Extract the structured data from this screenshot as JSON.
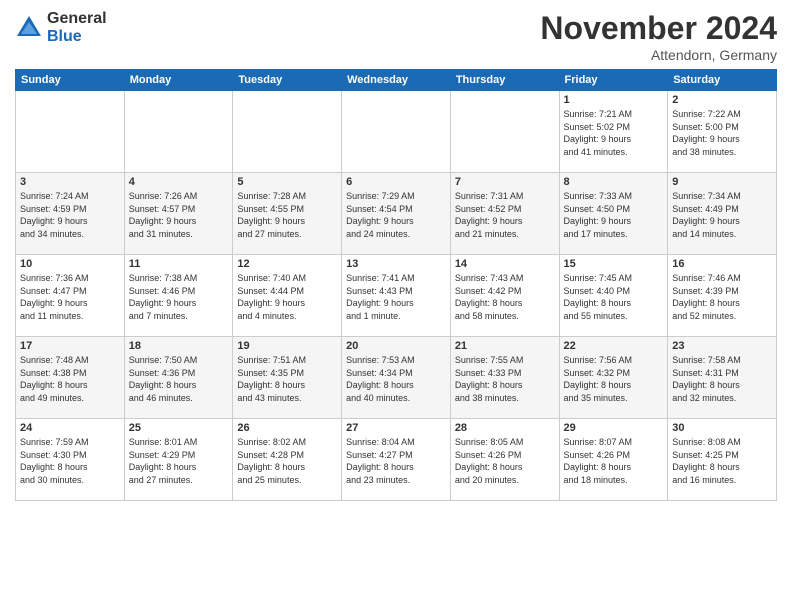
{
  "logo": {
    "general": "General",
    "blue": "Blue"
  },
  "header": {
    "month": "November 2024",
    "location": "Attendorn, Germany"
  },
  "days_of_week": [
    "Sunday",
    "Monday",
    "Tuesday",
    "Wednesday",
    "Thursday",
    "Friday",
    "Saturday"
  ],
  "weeks": [
    [
      {
        "day": "",
        "info": ""
      },
      {
        "day": "",
        "info": ""
      },
      {
        "day": "",
        "info": ""
      },
      {
        "day": "",
        "info": ""
      },
      {
        "day": "",
        "info": ""
      },
      {
        "day": "1",
        "info": "Sunrise: 7:21 AM\nSunset: 5:02 PM\nDaylight: 9 hours\nand 41 minutes."
      },
      {
        "day": "2",
        "info": "Sunrise: 7:22 AM\nSunset: 5:00 PM\nDaylight: 9 hours\nand 38 minutes."
      }
    ],
    [
      {
        "day": "3",
        "info": "Sunrise: 7:24 AM\nSunset: 4:59 PM\nDaylight: 9 hours\nand 34 minutes."
      },
      {
        "day": "4",
        "info": "Sunrise: 7:26 AM\nSunset: 4:57 PM\nDaylight: 9 hours\nand 31 minutes."
      },
      {
        "day": "5",
        "info": "Sunrise: 7:28 AM\nSunset: 4:55 PM\nDaylight: 9 hours\nand 27 minutes."
      },
      {
        "day": "6",
        "info": "Sunrise: 7:29 AM\nSunset: 4:54 PM\nDaylight: 9 hours\nand 24 minutes."
      },
      {
        "day": "7",
        "info": "Sunrise: 7:31 AM\nSunset: 4:52 PM\nDaylight: 9 hours\nand 21 minutes."
      },
      {
        "day": "8",
        "info": "Sunrise: 7:33 AM\nSunset: 4:50 PM\nDaylight: 9 hours\nand 17 minutes."
      },
      {
        "day": "9",
        "info": "Sunrise: 7:34 AM\nSunset: 4:49 PM\nDaylight: 9 hours\nand 14 minutes."
      }
    ],
    [
      {
        "day": "10",
        "info": "Sunrise: 7:36 AM\nSunset: 4:47 PM\nDaylight: 9 hours\nand 11 minutes."
      },
      {
        "day": "11",
        "info": "Sunrise: 7:38 AM\nSunset: 4:46 PM\nDaylight: 9 hours\nand 7 minutes."
      },
      {
        "day": "12",
        "info": "Sunrise: 7:40 AM\nSunset: 4:44 PM\nDaylight: 9 hours\nand 4 minutes."
      },
      {
        "day": "13",
        "info": "Sunrise: 7:41 AM\nSunset: 4:43 PM\nDaylight: 9 hours\nand 1 minute."
      },
      {
        "day": "14",
        "info": "Sunrise: 7:43 AM\nSunset: 4:42 PM\nDaylight: 8 hours\nand 58 minutes."
      },
      {
        "day": "15",
        "info": "Sunrise: 7:45 AM\nSunset: 4:40 PM\nDaylight: 8 hours\nand 55 minutes."
      },
      {
        "day": "16",
        "info": "Sunrise: 7:46 AM\nSunset: 4:39 PM\nDaylight: 8 hours\nand 52 minutes."
      }
    ],
    [
      {
        "day": "17",
        "info": "Sunrise: 7:48 AM\nSunset: 4:38 PM\nDaylight: 8 hours\nand 49 minutes."
      },
      {
        "day": "18",
        "info": "Sunrise: 7:50 AM\nSunset: 4:36 PM\nDaylight: 8 hours\nand 46 minutes."
      },
      {
        "day": "19",
        "info": "Sunrise: 7:51 AM\nSunset: 4:35 PM\nDaylight: 8 hours\nand 43 minutes."
      },
      {
        "day": "20",
        "info": "Sunrise: 7:53 AM\nSunset: 4:34 PM\nDaylight: 8 hours\nand 40 minutes."
      },
      {
        "day": "21",
        "info": "Sunrise: 7:55 AM\nSunset: 4:33 PM\nDaylight: 8 hours\nand 38 minutes."
      },
      {
        "day": "22",
        "info": "Sunrise: 7:56 AM\nSunset: 4:32 PM\nDaylight: 8 hours\nand 35 minutes."
      },
      {
        "day": "23",
        "info": "Sunrise: 7:58 AM\nSunset: 4:31 PM\nDaylight: 8 hours\nand 32 minutes."
      }
    ],
    [
      {
        "day": "24",
        "info": "Sunrise: 7:59 AM\nSunset: 4:30 PM\nDaylight: 8 hours\nand 30 minutes."
      },
      {
        "day": "25",
        "info": "Sunrise: 8:01 AM\nSunset: 4:29 PM\nDaylight: 8 hours\nand 27 minutes."
      },
      {
        "day": "26",
        "info": "Sunrise: 8:02 AM\nSunset: 4:28 PM\nDaylight: 8 hours\nand 25 minutes."
      },
      {
        "day": "27",
        "info": "Sunrise: 8:04 AM\nSunset: 4:27 PM\nDaylight: 8 hours\nand 23 minutes."
      },
      {
        "day": "28",
        "info": "Sunrise: 8:05 AM\nSunset: 4:26 PM\nDaylight: 8 hours\nand 20 minutes."
      },
      {
        "day": "29",
        "info": "Sunrise: 8:07 AM\nSunset: 4:26 PM\nDaylight: 8 hours\nand 18 minutes."
      },
      {
        "day": "30",
        "info": "Sunrise: 8:08 AM\nSunset: 4:25 PM\nDaylight: 8 hours\nand 16 minutes."
      }
    ]
  ]
}
